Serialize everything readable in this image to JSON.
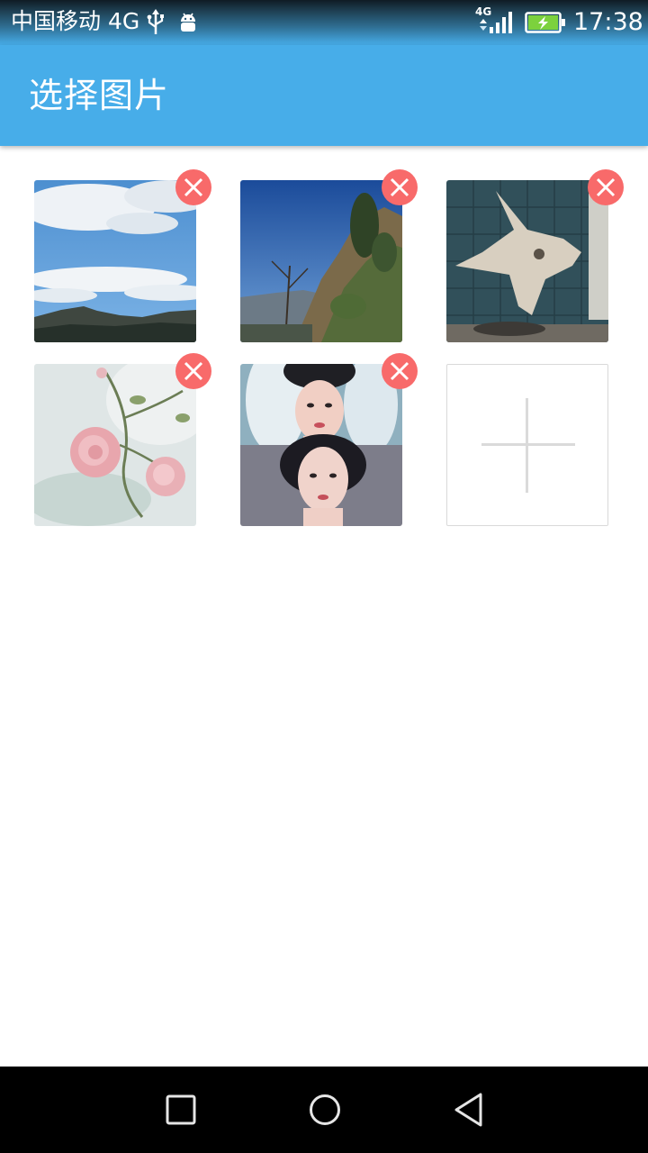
{
  "status_bar": {
    "carrier": "中国移动 4G",
    "network_type": "4G",
    "time": "17:38",
    "icons": [
      "usb-icon",
      "android-debug-icon",
      "signal-icon",
      "battery-charging-icon"
    ]
  },
  "app_bar": {
    "title": "选择图片",
    "background_color": "#47ade9"
  },
  "photos": [
    {
      "subject": "sky with clouds over mountains",
      "delete_icon": "close-icon"
    },
    {
      "subject": "hillside with trees and blue sky",
      "delete_icon": "close-icon"
    },
    {
      "subject": "sunfish statue against tiled wall",
      "delete_icon": "close-icon"
    },
    {
      "subject": "pink roses on branch",
      "delete_icon": "close-icon"
    },
    {
      "subject": "portrait collage of a woman",
      "delete_icon": "close-icon"
    }
  ],
  "add_tile": {
    "icon": "plus-icon"
  },
  "accent_colors": {
    "delete_button": "#f86a6a",
    "add_tile_border": "#d9d9d9"
  },
  "nav_bar": {
    "buttons": [
      "recent-apps-icon",
      "home-icon",
      "back-icon"
    ]
  }
}
